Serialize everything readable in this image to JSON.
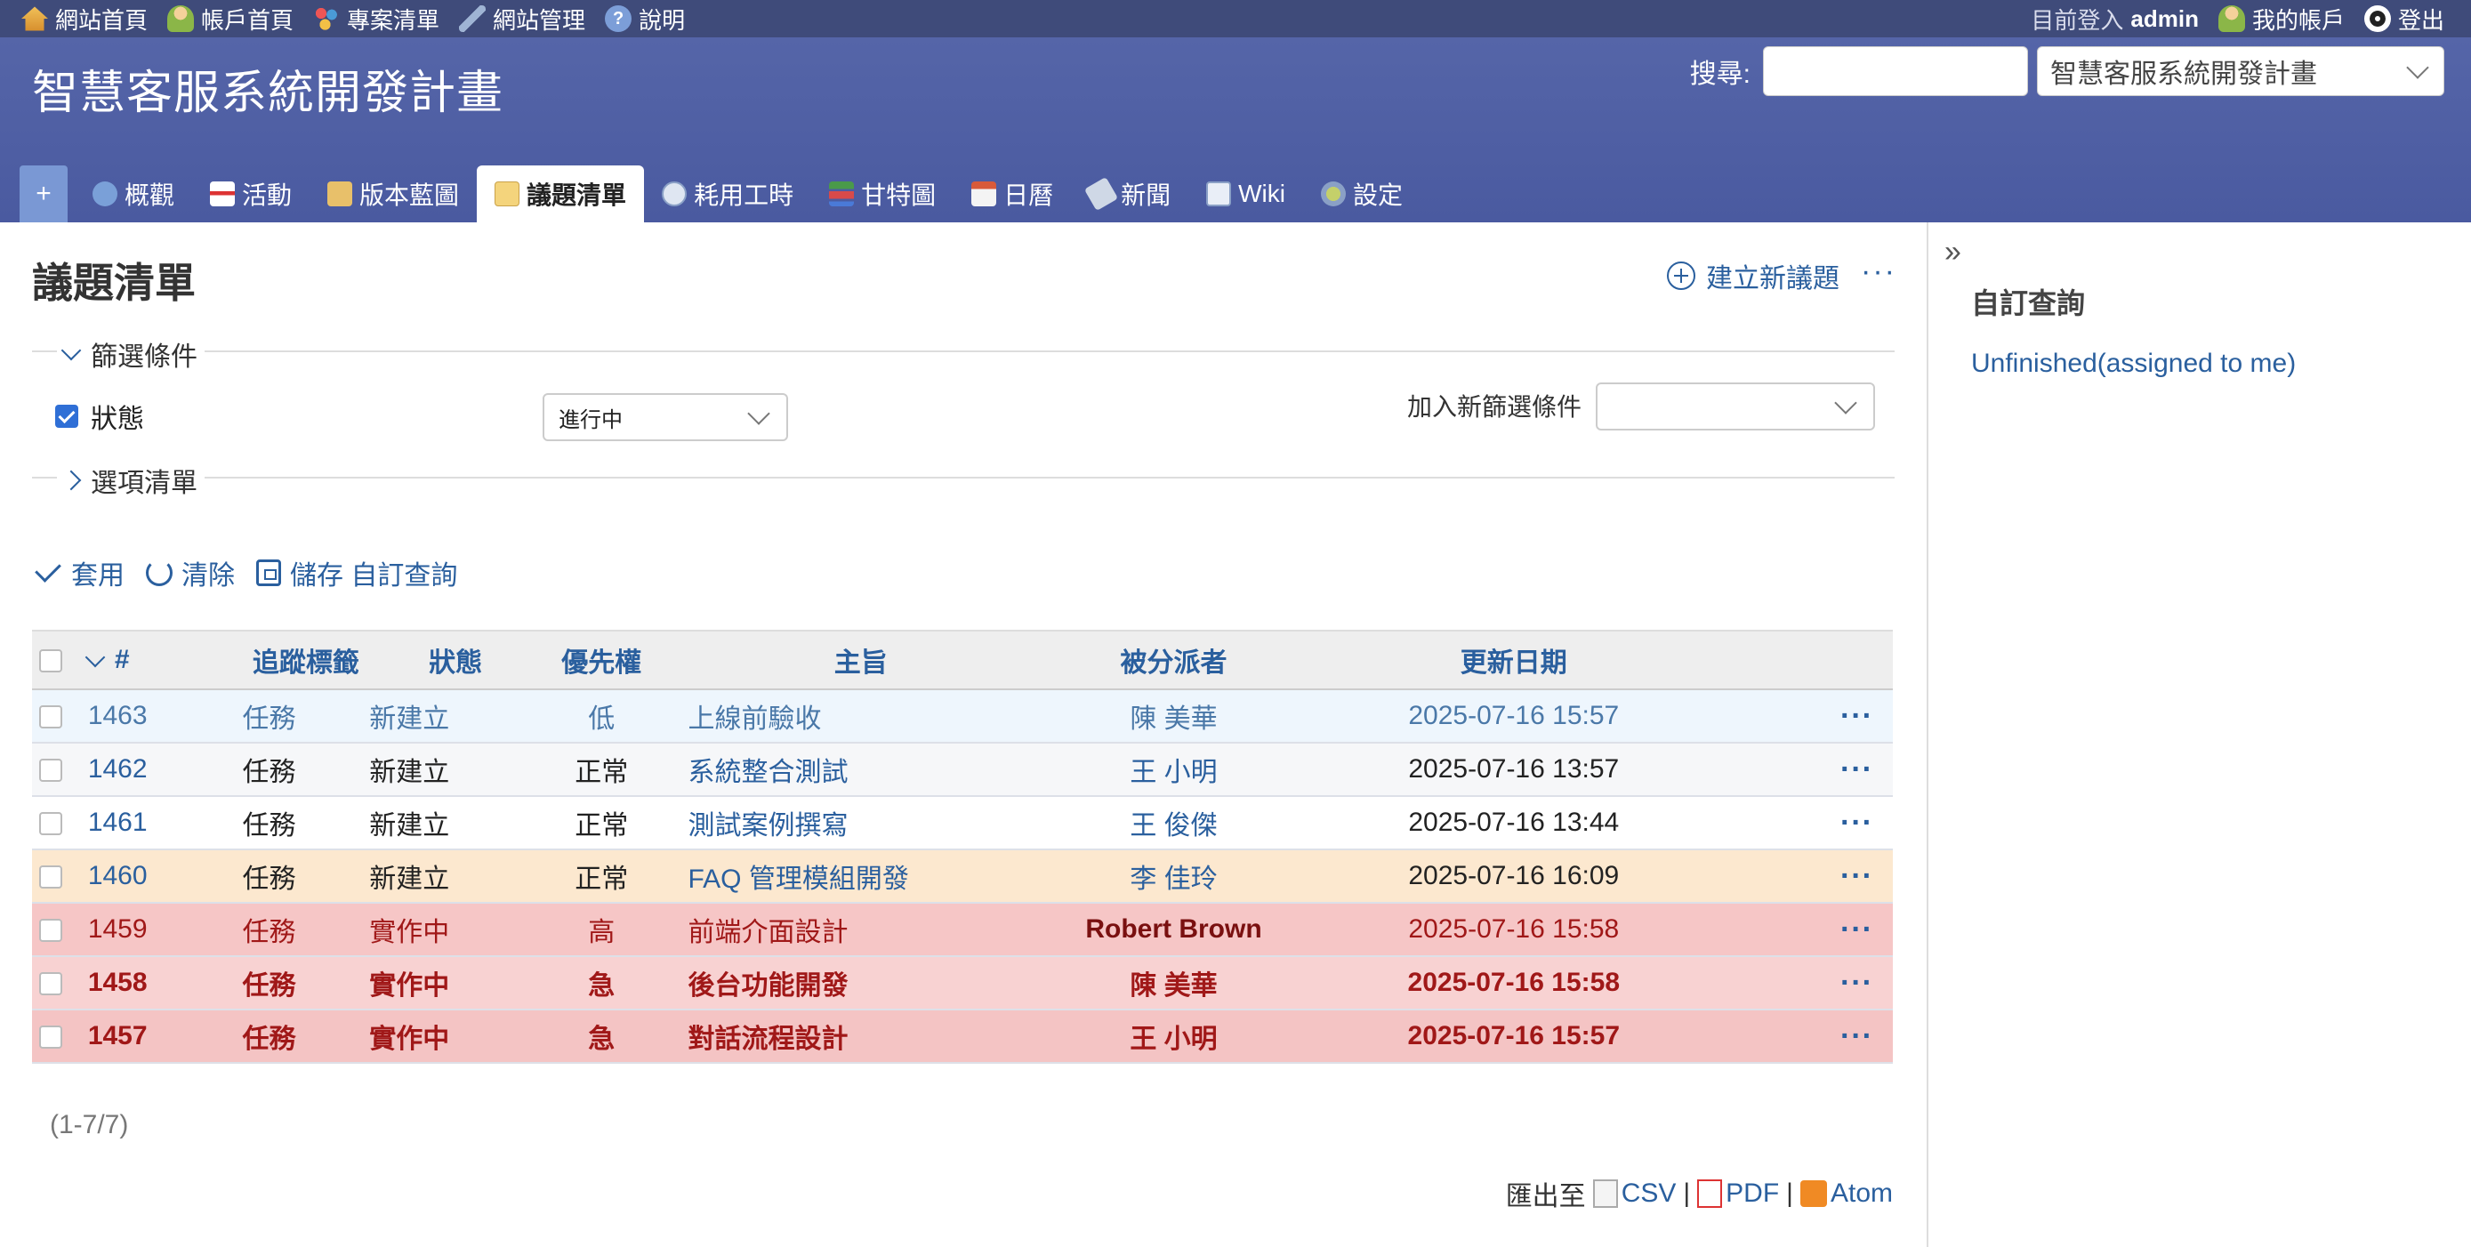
{
  "top_menu": {
    "left": [
      {
        "label": "網站首頁",
        "icon": "home-icon"
      },
      {
        "label": "帳戶首頁",
        "icon": "user-icon"
      },
      {
        "label": "專案清單",
        "icon": "projects-icon"
      },
      {
        "label": "網站管理",
        "icon": "admin-wrench-icon"
      },
      {
        "label": "說明",
        "icon": "help-icon"
      }
    ],
    "logged_in_prefix": "目前登入",
    "logged_in_user": "admin",
    "my_account": "我的帳戶",
    "logout": "登出"
  },
  "header": {
    "project_title": "智慧客服系統開發計畫",
    "search_label": "搜尋:",
    "search_value": "",
    "project_jump_selected": "智慧客服系統開發計畫"
  },
  "tabs": [
    {
      "label": "+",
      "icon": ""
    },
    {
      "label": "概觀",
      "icon": "info-icon"
    },
    {
      "label": "活動",
      "icon": "activity-icon"
    },
    {
      "label": "版本藍圖",
      "icon": "roadmap-box-icon"
    },
    {
      "label": "議題清單",
      "icon": "issues-icon",
      "selected": true
    },
    {
      "label": "耗用工時",
      "icon": "time-icon"
    },
    {
      "label": "甘特圖",
      "icon": "gantt-icon"
    },
    {
      "label": "日曆",
      "icon": "calendar-icon"
    },
    {
      "label": "新聞",
      "icon": "news-icon"
    },
    {
      "label": "Wiki",
      "icon": "wiki-icon"
    },
    {
      "label": "設定",
      "icon": "settings-icon"
    }
  ],
  "main": {
    "title": "議題清單",
    "new_issue": "建立新議題",
    "more": "···",
    "filters_legend": "篩選條件",
    "status_filter_label": "狀態",
    "status_operator": "進行中",
    "add_filter_label": "加入新篩選條件",
    "options_legend": "選項清單",
    "apply": "套用",
    "clear": "清除",
    "save_query": "儲存 自訂查詢"
  },
  "table": {
    "columns": [
      "#",
      "追蹤標籤",
      "狀態",
      "優先權",
      "主旨",
      "被分派者",
      "更新日期"
    ],
    "rows": [
      {
        "id": "1463",
        "tracker": "任務",
        "status": "新建立",
        "priority": "低",
        "subject": "上線前驗收",
        "assignee": "陳 美華",
        "updated": "2025-07-16 15:57",
        "style": "p-low"
      },
      {
        "id": "1462",
        "tracker": "任務",
        "status": "新建立",
        "priority": "正常",
        "subject": "系統整合測試",
        "assignee": "王 小明",
        "updated": "2025-07-16 13:57",
        "style": "p-normal"
      },
      {
        "id": "1461",
        "tracker": "任務",
        "status": "新建立",
        "priority": "正常",
        "subject": "測試案例撰寫",
        "assignee": "王 俊傑",
        "updated": "2025-07-16 13:44",
        "style": "p-normal2"
      },
      {
        "id": "1460",
        "tracker": "任務",
        "status": "新建立",
        "priority": "正常",
        "subject": "FAQ 管理模組開發",
        "assignee": "李 佳玲",
        "updated": "2025-07-16 16:09",
        "style": "p-prio"
      },
      {
        "id": "1459",
        "tracker": "任務",
        "status": "實作中",
        "priority": "高",
        "subject": "前端介面設計",
        "assignee": "Robert Brown",
        "updated": "2025-07-16 15:58",
        "style": "p-high"
      },
      {
        "id": "1458",
        "tracker": "任務",
        "status": "實作中",
        "priority": "急",
        "subject": "後台功能開發",
        "assignee": "陳 美華",
        "updated": "2025-07-16 15:58",
        "style": "p-urgent"
      },
      {
        "id": "1457",
        "tracker": "任務",
        "status": "實作中",
        "priority": "急",
        "subject": "對話流程設計",
        "assignee": "王 小明",
        "updated": "2025-07-16 15:57",
        "style": "p-urgent2"
      }
    ],
    "row_actions": "···"
  },
  "pagination": "(1-7/7)",
  "export": {
    "prefix": "匯出至",
    "csv": "CSV",
    "pdf": "PDF",
    "atom": "Atom",
    "sep": "|"
  },
  "sidebar": {
    "toggle": "»",
    "heading": "自訂查詢",
    "queries": [
      "Unfinished(assigned to me)"
    ]
  }
}
